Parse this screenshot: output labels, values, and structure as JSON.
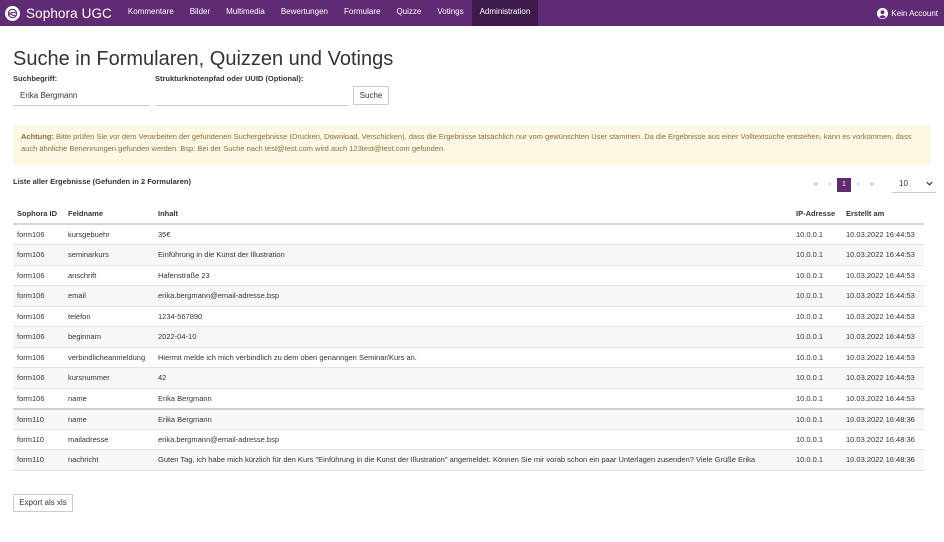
{
  "app": {
    "name": "Sophora UGC"
  },
  "nav": {
    "items": [
      {
        "label": "Kommentare"
      },
      {
        "label": "Bilder"
      },
      {
        "label": "Multimedia"
      },
      {
        "label": "Bewertungen"
      },
      {
        "label": "Formulare"
      },
      {
        "label": "Quizze"
      },
      {
        "label": "Votings"
      },
      {
        "label": "Administration",
        "active": true
      }
    ],
    "account_label": "Kein Account"
  },
  "page": {
    "title": "Suche in Formularen, Quizzen und Votings"
  },
  "search": {
    "term_label": "Suchbegriff:",
    "term_value": "Erika Bergmann",
    "path_label": "Strukturknotenpfad oder UUID (Optional):",
    "path_value": "",
    "button_label": "Suche"
  },
  "alert": {
    "bold": "Achtung:",
    "text": " Bitte prüfen Sie vor dem Verarbeiten der gefundenen Suchergebnisse (Drucken, Download, Verschicken), dass die Ergebnisse tatsächlich nur vom gewünschten User stammen. Da die Ergebnisse aus einer Volltextsuche entstehen, kann es vorkommen, dass auch ähnliche Benennungen gefunden werden. Bsp: Bei der Suche nach test@test.com wird auch 123test@test.com gefunden."
  },
  "results": {
    "title": "Liste aller Ergebnisse (Gefunden in 2 Formularen)",
    "pager": {
      "first": "«",
      "prev": "‹",
      "current": "1",
      "next": "›",
      "last": "»"
    },
    "per_page": "10",
    "columns": [
      "Sophora ID",
      "Feldname",
      "Inhalt",
      "IP-Adresse",
      "Erstellt am"
    ],
    "rows": [
      {
        "id": "form106",
        "field": "kursgebuehr",
        "content": "35€",
        "ip": "10.0.0.1",
        "created": "10.03.2022 16:44:53"
      },
      {
        "id": "form106",
        "field": "seminarkurs",
        "content": "Einführung in die Kunst der Illustration",
        "ip": "10.0.0.1",
        "created": "10.03.2022 16:44:53"
      },
      {
        "id": "form106",
        "field": "anschrift",
        "content": "Hafenstraße 23",
        "ip": "10.0.0.1",
        "created": "10.03.2022 16:44:53"
      },
      {
        "id": "form106",
        "field": "email",
        "content": "erika.bergmann@email-adresse.bsp",
        "ip": "10.0.0.1",
        "created": "10.03.2022 16:44:53"
      },
      {
        "id": "form106",
        "field": "telefon",
        "content": "1234-567890",
        "ip": "10.0.0.1",
        "created": "10.03.2022 16:44:53"
      },
      {
        "id": "form106",
        "field": "beginnam",
        "content": "2022-04-10",
        "ip": "10.0.0.1",
        "created": "10.03.2022 16:44:53"
      },
      {
        "id": "form106",
        "field": "verbindlicheanmeldung",
        "content": "Hiermit melde ich mich verbindlich zu dem oben genanngen Seminar/Kurs an.",
        "ip": "10.0.0.1",
        "created": "10.03.2022 16:44:53"
      },
      {
        "id": "form106",
        "field": "kursnummer",
        "content": "42",
        "ip": "10.0.0.1",
        "created": "10.03.2022 16:44:53"
      },
      {
        "id": "form106",
        "field": "name",
        "content": "Erika Bergmann",
        "ip": "10.0.0.1",
        "created": "10.03.2022 16:44:53"
      },
      {
        "id": "form110",
        "field": "name",
        "content": "Erika Bergmann",
        "ip": "10.0.0.1",
        "created": "10.03.2022 16:48:36"
      },
      {
        "id": "form110",
        "field": "mailadresse",
        "content": "erika.bergmann@email-adresse.bsp",
        "ip": "10.0.0.1",
        "created": "10.03.2022 16:48:36"
      },
      {
        "id": "form110",
        "field": "nachricht",
        "content": "Guten Tag, ich habe mich kürzlich für den Kurs \"Einführung in die Kunst der Illustration\" angemeldet. Können Sie mir vorab schon ein paar Unterlagen zusenden? Viele Grüße Erika",
        "ip": "10.0.0.1",
        "created": "10.03.2022 16:48:36"
      }
    ],
    "export_label": "Export als xls"
  },
  "icons": {
    "logo": "sophora-logo-icon",
    "account": "user-circle-icon",
    "dropdown": "chevron-down-icon"
  },
  "colors": {
    "brand": "#5f2b73",
    "nav_active": "#3e1a4c",
    "alert_bg": "#fcf8e3",
    "alert_text": "#8a6d3b"
  }
}
